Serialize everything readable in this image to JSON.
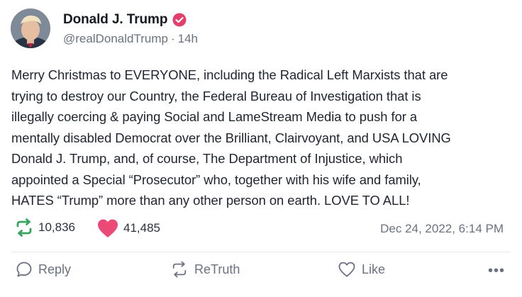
{
  "post": {
    "author": {
      "display_name": "Donald J. Trump",
      "handle": "@realDonaldTrump",
      "separator": "·",
      "time_ago": "14h",
      "verified_color": "#e33f6e"
    },
    "body_lines": [
      "Merry Christmas to EVERYONE, including the Radical Left Marxists that are",
      "trying to destroy our Country, the Federal Bureau of Investigation that is",
      "illegally coercing & paying Social and LameStream Media to push for a",
      "mentally disabled Democrat over the Brilliant, Clairvoyant, and USA LOVING",
      "Donald J. Trump,  and, of course, The Department of Injustice, which",
      "appointed a Special “Prosecutor” who, together with his wife and family,",
      "HATES “Trump” more than any other person on earth. LOVE TO ALL!"
    ],
    "stats": {
      "retruths": "10,836",
      "likes": "41,485",
      "timestamp": "Dec 24, 2022, 6:14 PM",
      "retruth_icon_color": "#3aa35f",
      "like_icon_color": "#ec4a76"
    },
    "actions": {
      "reply": "Reply",
      "retruth": "ReTruth",
      "like": "Like",
      "more": "•••"
    },
    "icons": {
      "avatar": "avatar",
      "verified": "verified-badge-icon",
      "retruth": "retruth-icon",
      "heart": "heart-icon",
      "reply": "reply-bubble-icon",
      "more": "more-options-icon"
    }
  }
}
